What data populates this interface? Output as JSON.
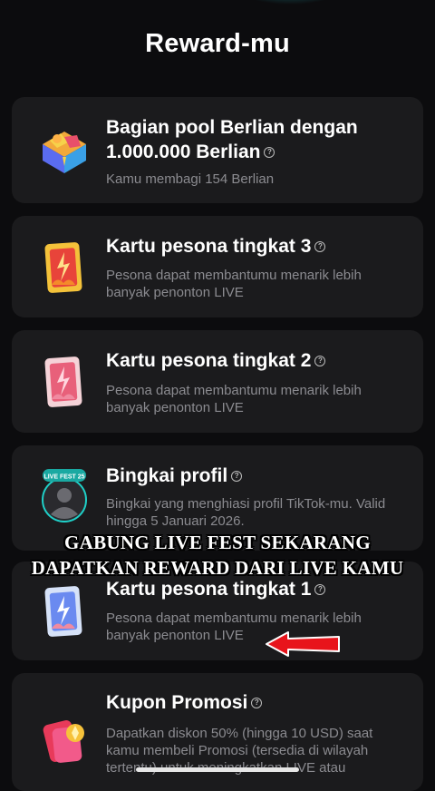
{
  "header": {
    "title": "Reward-mu"
  },
  "rewards": [
    {
      "title": "Bagian pool Berlian dengan 1.000.000 Berlian",
      "description": "Kamu membagi 154 Berlian",
      "icon": "diamond-chest-icon"
    },
    {
      "title": "Kartu pesona tingkat 3",
      "description": "Pesona dapat membantumu menarik lebih banyak penonton LIVE",
      "icon": "gold-charm-card-icon"
    },
    {
      "title": "Kartu pesona tingkat 2",
      "description": "Pesona dapat membantumu menarik lebih banyak penonton LIVE",
      "icon": "pink-charm-card-icon"
    },
    {
      "title": "Bingkai profil",
      "description": "Bingkai yang menghiasi profil TikTok-mu. Valid hingga 5 Januari 2026.",
      "icon": "profile-frame-icon",
      "badge": "LIVE FEST 25"
    },
    {
      "title": "Kartu pesona tingkat 1",
      "description": "Pesona dapat membantumu menarik lebih banyak penonton LIVE",
      "icon": "blue-charm-card-icon"
    },
    {
      "title": "Kupon Promosi",
      "description": "Dapatkan diskon 50% (hingga 10 USD) saat kamu membeli Promosi (tersedia di wilayah tertentu) untuk meningkatkan LIVE atau",
      "icon": "promo-coupon-icon"
    }
  ],
  "overlay_caption": {
    "line1": "GABUNG LIVE FEST SEKARANG",
    "line2": "DAPATKAN REWARD DARI LIVE KAMU"
  },
  "help_glyph": "?",
  "colors": {
    "background": "#0c0c0e",
    "card": "#1b1b1d",
    "arrow": "#e8141b",
    "muted_text": "#8b8b90"
  }
}
